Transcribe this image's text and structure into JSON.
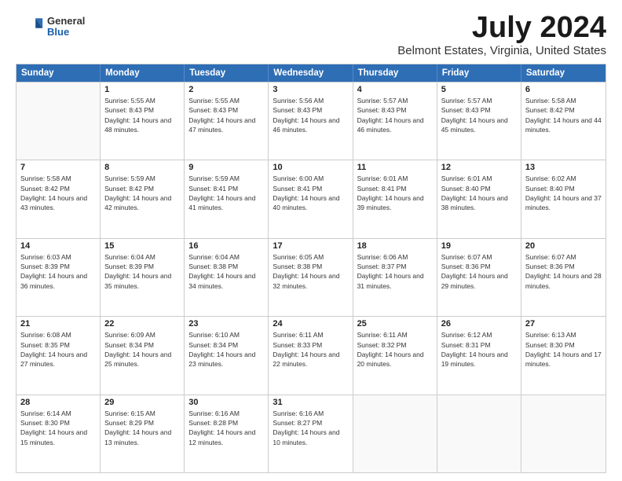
{
  "header": {
    "logo_general": "General",
    "logo_blue": "Blue",
    "month": "July 2024",
    "location": "Belmont Estates, Virginia, United States"
  },
  "weekdays": [
    "Sunday",
    "Monday",
    "Tuesday",
    "Wednesday",
    "Thursday",
    "Friday",
    "Saturday"
  ],
  "weeks": [
    [
      {
        "day": "",
        "sunrise": "",
        "sunset": "",
        "daylight": ""
      },
      {
        "day": "1",
        "sunrise": "Sunrise: 5:55 AM",
        "sunset": "Sunset: 8:43 PM",
        "daylight": "Daylight: 14 hours and 48 minutes."
      },
      {
        "day": "2",
        "sunrise": "Sunrise: 5:55 AM",
        "sunset": "Sunset: 8:43 PM",
        "daylight": "Daylight: 14 hours and 47 minutes."
      },
      {
        "day": "3",
        "sunrise": "Sunrise: 5:56 AM",
        "sunset": "Sunset: 8:43 PM",
        "daylight": "Daylight: 14 hours and 46 minutes."
      },
      {
        "day": "4",
        "sunrise": "Sunrise: 5:57 AM",
        "sunset": "Sunset: 8:43 PM",
        "daylight": "Daylight: 14 hours and 46 minutes."
      },
      {
        "day": "5",
        "sunrise": "Sunrise: 5:57 AM",
        "sunset": "Sunset: 8:43 PM",
        "daylight": "Daylight: 14 hours and 45 minutes."
      },
      {
        "day": "6",
        "sunrise": "Sunrise: 5:58 AM",
        "sunset": "Sunset: 8:42 PM",
        "daylight": "Daylight: 14 hours and 44 minutes."
      }
    ],
    [
      {
        "day": "7",
        "sunrise": "Sunrise: 5:58 AM",
        "sunset": "Sunset: 8:42 PM",
        "daylight": "Daylight: 14 hours and 43 minutes."
      },
      {
        "day": "8",
        "sunrise": "Sunrise: 5:59 AM",
        "sunset": "Sunset: 8:42 PM",
        "daylight": "Daylight: 14 hours and 42 minutes."
      },
      {
        "day": "9",
        "sunrise": "Sunrise: 5:59 AM",
        "sunset": "Sunset: 8:41 PM",
        "daylight": "Daylight: 14 hours and 41 minutes."
      },
      {
        "day": "10",
        "sunrise": "Sunrise: 6:00 AM",
        "sunset": "Sunset: 8:41 PM",
        "daylight": "Daylight: 14 hours and 40 minutes."
      },
      {
        "day": "11",
        "sunrise": "Sunrise: 6:01 AM",
        "sunset": "Sunset: 8:41 PM",
        "daylight": "Daylight: 14 hours and 39 minutes."
      },
      {
        "day": "12",
        "sunrise": "Sunrise: 6:01 AM",
        "sunset": "Sunset: 8:40 PM",
        "daylight": "Daylight: 14 hours and 38 minutes."
      },
      {
        "day": "13",
        "sunrise": "Sunrise: 6:02 AM",
        "sunset": "Sunset: 8:40 PM",
        "daylight": "Daylight: 14 hours and 37 minutes."
      }
    ],
    [
      {
        "day": "14",
        "sunrise": "Sunrise: 6:03 AM",
        "sunset": "Sunset: 8:39 PM",
        "daylight": "Daylight: 14 hours and 36 minutes."
      },
      {
        "day": "15",
        "sunrise": "Sunrise: 6:04 AM",
        "sunset": "Sunset: 8:39 PM",
        "daylight": "Daylight: 14 hours and 35 minutes."
      },
      {
        "day": "16",
        "sunrise": "Sunrise: 6:04 AM",
        "sunset": "Sunset: 8:38 PM",
        "daylight": "Daylight: 14 hours and 34 minutes."
      },
      {
        "day": "17",
        "sunrise": "Sunrise: 6:05 AM",
        "sunset": "Sunset: 8:38 PM",
        "daylight": "Daylight: 14 hours and 32 minutes."
      },
      {
        "day": "18",
        "sunrise": "Sunrise: 6:06 AM",
        "sunset": "Sunset: 8:37 PM",
        "daylight": "Daylight: 14 hours and 31 minutes."
      },
      {
        "day": "19",
        "sunrise": "Sunrise: 6:07 AM",
        "sunset": "Sunset: 8:36 PM",
        "daylight": "Daylight: 14 hours and 29 minutes."
      },
      {
        "day": "20",
        "sunrise": "Sunrise: 6:07 AM",
        "sunset": "Sunset: 8:36 PM",
        "daylight": "Daylight: 14 hours and 28 minutes."
      }
    ],
    [
      {
        "day": "21",
        "sunrise": "Sunrise: 6:08 AM",
        "sunset": "Sunset: 8:35 PM",
        "daylight": "Daylight: 14 hours and 27 minutes."
      },
      {
        "day": "22",
        "sunrise": "Sunrise: 6:09 AM",
        "sunset": "Sunset: 8:34 PM",
        "daylight": "Daylight: 14 hours and 25 minutes."
      },
      {
        "day": "23",
        "sunrise": "Sunrise: 6:10 AM",
        "sunset": "Sunset: 8:34 PM",
        "daylight": "Daylight: 14 hours and 23 minutes."
      },
      {
        "day": "24",
        "sunrise": "Sunrise: 6:11 AM",
        "sunset": "Sunset: 8:33 PM",
        "daylight": "Daylight: 14 hours and 22 minutes."
      },
      {
        "day": "25",
        "sunrise": "Sunrise: 6:11 AM",
        "sunset": "Sunset: 8:32 PM",
        "daylight": "Daylight: 14 hours and 20 minutes."
      },
      {
        "day": "26",
        "sunrise": "Sunrise: 6:12 AM",
        "sunset": "Sunset: 8:31 PM",
        "daylight": "Daylight: 14 hours and 19 minutes."
      },
      {
        "day": "27",
        "sunrise": "Sunrise: 6:13 AM",
        "sunset": "Sunset: 8:30 PM",
        "daylight": "Daylight: 14 hours and 17 minutes."
      }
    ],
    [
      {
        "day": "28",
        "sunrise": "Sunrise: 6:14 AM",
        "sunset": "Sunset: 8:30 PM",
        "daylight": "Daylight: 14 hours and 15 minutes."
      },
      {
        "day": "29",
        "sunrise": "Sunrise: 6:15 AM",
        "sunset": "Sunset: 8:29 PM",
        "daylight": "Daylight: 14 hours and 13 minutes."
      },
      {
        "day": "30",
        "sunrise": "Sunrise: 6:16 AM",
        "sunset": "Sunset: 8:28 PM",
        "daylight": "Daylight: 14 hours and 12 minutes."
      },
      {
        "day": "31",
        "sunrise": "Sunrise: 6:16 AM",
        "sunset": "Sunset: 8:27 PM",
        "daylight": "Daylight: 14 hours and 10 minutes."
      },
      {
        "day": "",
        "sunrise": "",
        "sunset": "",
        "daylight": ""
      },
      {
        "day": "",
        "sunrise": "",
        "sunset": "",
        "daylight": ""
      },
      {
        "day": "",
        "sunrise": "",
        "sunset": "",
        "daylight": ""
      }
    ]
  ]
}
